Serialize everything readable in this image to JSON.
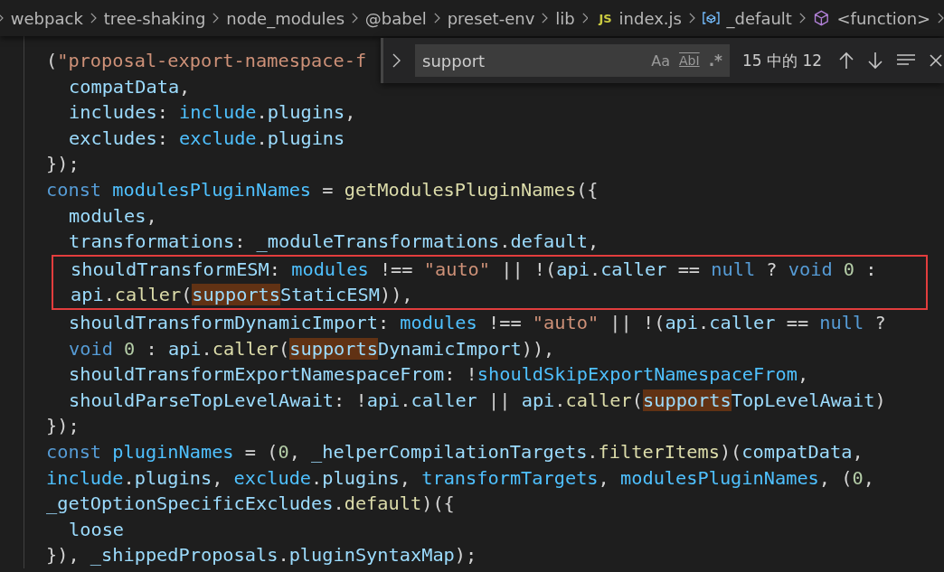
{
  "breadcrumbs": [
    {
      "label": "webpack",
      "kind": "folder"
    },
    {
      "label": "tree-shaking",
      "kind": "folder"
    },
    {
      "label": "node_modules",
      "kind": "folder"
    },
    {
      "label": "@babel",
      "kind": "folder"
    },
    {
      "label": "preset-env",
      "kind": "folder"
    },
    {
      "label": "lib",
      "kind": "folder"
    },
    {
      "label": "index.js",
      "kind": "file",
      "icon_text": "JS"
    },
    {
      "label": "_default",
      "kind": "field"
    },
    {
      "label": "<function>",
      "kind": "method"
    }
  ],
  "find_widget": {
    "value": "support",
    "options": [
      "Aa",
      "AbI",
      ".*"
    ],
    "count": "15 中的 12"
  },
  "code": [
    {
      "kind": "line",
      "tokens": [
        {
          "t": "(",
          "kind": "punct"
        },
        {
          "t": "\"proposal-export-namespace-f",
          "kind": "string"
        }
      ],
      "children": [
        {
          "kind": "line",
          "tokens": [
            {
              "t": "compatData",
              "kind": "property"
            },
            {
              "t": ",",
              "kind": "punct"
            }
          ]
        },
        {
          "kind": "line",
          "tokens": [
            {
              "t": "includes",
              "kind": "property"
            },
            {
              "t": ": ",
              "kind": "punct"
            },
            {
              "t": "include",
              "kind": "variable"
            },
            {
              "t": ".",
              "kind": "punct"
            },
            {
              "t": "plugins",
              "kind": "property"
            },
            {
              "t": ",",
              "kind": "punct"
            }
          ]
        },
        {
          "kind": "line",
          "tokens": [
            {
              "t": "excludes",
              "kind": "property"
            },
            {
              "t": ": ",
              "kind": "punct"
            },
            {
              "t": "exclude",
              "kind": "variable"
            },
            {
              "t": ".",
              "kind": "punct"
            },
            {
              "t": "plugins",
              "kind": "property"
            }
          ]
        }
      ]
    },
    {
      "kind": "line",
      "tokens": [
        {
          "t": "});",
          "kind": "punct"
        }
      ]
    },
    {
      "kind": "line",
      "tokens": [
        {
          "t": "const ",
          "kind": "keyword"
        },
        {
          "t": "modulesPluginNames",
          "kind": "variable"
        },
        {
          "t": " = ",
          "kind": "punct"
        },
        {
          "t": "getModulesPluginNames",
          "kind": "function"
        },
        {
          "t": "({",
          "kind": "punct"
        }
      ],
      "children": [
        {
          "kind": "line",
          "tokens": [
            {
              "t": "modules",
              "kind": "property"
            },
            {
              "t": ",",
              "kind": "punct"
            }
          ]
        },
        {
          "kind": "line",
          "tokens": [
            {
              "t": "transformations",
              "kind": "property"
            },
            {
              "t": ": ",
              "kind": "punct"
            },
            {
              "t": "_moduleTransformations",
              "kind": "property"
            },
            {
              "t": ".",
              "kind": "punct"
            },
            {
              "t": "default",
              "kind": "property"
            },
            {
              "t": ",",
              "kind": "punct"
            }
          ]
        },
        {
          "kind": "boxed",
          "lines": [
            {
              "tokens": [
                {
                  "t": "shouldTransformESM",
                  "kind": "property"
                },
                {
                  "t": ": ",
                  "kind": "punct"
                },
                {
                  "t": "modules",
                  "kind": "variable"
                },
                {
                  "t": " !== ",
                  "kind": "punct"
                },
                {
                  "t": "\"auto\"",
                  "kind": "string"
                },
                {
                  "t": " || !(",
                  "kind": "punct"
                },
                {
                  "t": "api",
                  "kind": "property"
                },
                {
                  "t": ".",
                  "kind": "punct"
                },
                {
                  "t": "caller",
                  "kind": "property"
                },
                {
                  "t": " == ",
                  "kind": "punct"
                },
                {
                  "t": "null",
                  "kind": "keyword"
                },
                {
                  "t": " ? ",
                  "kind": "punct"
                },
                {
                  "t": "void ",
                  "kind": "keyword"
                },
                {
                  "t": "0",
                  "kind": "number"
                },
                {
                  "t": " :",
                  "kind": "punct"
                }
              ]
            },
            {
              "tokens": [
                {
                  "t": "api",
                  "kind": "property"
                },
                {
                  "t": ".",
                  "kind": "punct"
                },
                {
                  "t": "caller",
                  "kind": "function"
                },
                {
                  "t": "(",
                  "kind": "punct"
                },
                {
                  "t": "supports",
                  "kind": "match"
                },
                {
                  "t": "StaticESM",
                  "kind": "property"
                },
                {
                  "t": ")),",
                  "kind": "punct"
                }
              ]
            }
          ]
        },
        {
          "kind": "line",
          "tokens": [
            {
              "t": "shouldTransformDynamicImport",
              "kind": "property"
            },
            {
              "t": ": ",
              "kind": "punct"
            },
            {
              "t": "modules",
              "kind": "variable"
            },
            {
              "t": " !== ",
              "kind": "punct"
            },
            {
              "t": "\"auto\"",
              "kind": "string"
            },
            {
              "t": " || !(",
              "kind": "punct"
            },
            {
              "t": "api",
              "kind": "property"
            },
            {
              "t": ".",
              "kind": "punct"
            },
            {
              "t": "caller",
              "kind": "property"
            },
            {
              "t": " == ",
              "kind": "punct"
            },
            {
              "t": "null",
              "kind": "keyword"
            },
            {
              "t": " ?",
              "kind": "punct"
            }
          ]
        },
        {
          "kind": "line",
          "tokens": [
            {
              "t": "void ",
              "kind": "keyword"
            },
            {
              "t": "0",
              "kind": "number"
            },
            {
              "t": " : ",
              "kind": "punct"
            },
            {
              "t": "api",
              "kind": "property"
            },
            {
              "t": ".",
              "kind": "punct"
            },
            {
              "t": "caller",
              "kind": "function"
            },
            {
              "t": "(",
              "kind": "punct"
            },
            {
              "t": "supports",
              "kind": "match"
            },
            {
              "t": "DynamicImport",
              "kind": "property"
            },
            {
              "t": ")),",
              "kind": "punct"
            }
          ]
        },
        {
          "kind": "line",
          "tokens": [
            {
              "t": "shouldTransformExportNamespaceFrom",
              "kind": "property"
            },
            {
              "t": ": !",
              "kind": "punct"
            },
            {
              "t": "shouldSkipExportNamespaceFrom",
              "kind": "variable"
            },
            {
              "t": ",",
              "kind": "punct"
            }
          ]
        },
        {
          "kind": "line",
          "tokens": [
            {
              "t": "shouldParseTopLevelAwait",
              "kind": "property"
            },
            {
              "t": ": !",
              "kind": "punct"
            },
            {
              "t": "api",
              "kind": "property"
            },
            {
              "t": ".",
              "kind": "punct"
            },
            {
              "t": "caller",
              "kind": "property"
            },
            {
              "t": " || ",
              "kind": "punct"
            },
            {
              "t": "api",
              "kind": "property"
            },
            {
              "t": ".",
              "kind": "punct"
            },
            {
              "t": "caller",
              "kind": "function"
            },
            {
              "t": "(",
              "kind": "punct"
            },
            {
              "t": "supports",
              "kind": "match"
            },
            {
              "t": "TopLevelAwait",
              "kind": "property"
            },
            {
              "t": ")",
              "kind": "punct"
            }
          ]
        }
      ]
    },
    {
      "kind": "line",
      "tokens": [
        {
          "t": "});",
          "kind": "punct"
        }
      ]
    },
    {
      "kind": "line",
      "tokens": [
        {
          "t": "const ",
          "kind": "keyword"
        },
        {
          "t": "pluginNames",
          "kind": "variable"
        },
        {
          "t": " = (",
          "kind": "punct"
        },
        {
          "t": "0",
          "kind": "number"
        },
        {
          "t": ", ",
          "kind": "punct"
        },
        {
          "t": "_helperCompilationTargets",
          "kind": "property"
        },
        {
          "t": ".",
          "kind": "punct"
        },
        {
          "t": "filterItems",
          "kind": "function"
        },
        {
          "t": ")(",
          "kind": "punct"
        },
        {
          "t": "compatData",
          "kind": "property"
        },
        {
          "t": ",",
          "kind": "punct"
        }
      ]
    },
    {
      "kind": "line",
      "tokens": [
        {
          "t": "include",
          "kind": "variable"
        },
        {
          "t": ".",
          "kind": "punct"
        },
        {
          "t": "plugins",
          "kind": "property"
        },
        {
          "t": ", ",
          "kind": "punct"
        },
        {
          "t": "exclude",
          "kind": "variable"
        },
        {
          "t": ".",
          "kind": "punct"
        },
        {
          "t": "plugins",
          "kind": "property"
        },
        {
          "t": ", ",
          "kind": "punct"
        },
        {
          "t": "transformTargets",
          "kind": "variable"
        },
        {
          "t": ", ",
          "kind": "punct"
        },
        {
          "t": "modulesPluginNames",
          "kind": "variable"
        },
        {
          "t": ", (",
          "kind": "punct"
        },
        {
          "t": "0",
          "kind": "number"
        },
        {
          "t": ",",
          "kind": "punct"
        }
      ]
    },
    {
      "kind": "line",
      "tokens": [
        {
          "t": "_getOptionSpecificExcludes",
          "kind": "property"
        },
        {
          "t": ".",
          "kind": "punct"
        },
        {
          "t": "default",
          "kind": "function"
        },
        {
          "t": ")({",
          "kind": "punct"
        }
      ],
      "children": [
        {
          "kind": "line",
          "tokens": [
            {
              "t": "loose",
              "kind": "property"
            }
          ]
        }
      ]
    },
    {
      "kind": "line",
      "tokens": [
        {
          "t": "}), ",
          "kind": "punct"
        },
        {
          "t": "_shippedProposals",
          "kind": "property"
        },
        {
          "t": ".",
          "kind": "punct"
        },
        {
          "t": "pluginSyntaxMap",
          "kind": "property"
        },
        {
          "t": ");",
          "kind": "punct"
        }
      ]
    }
  ]
}
